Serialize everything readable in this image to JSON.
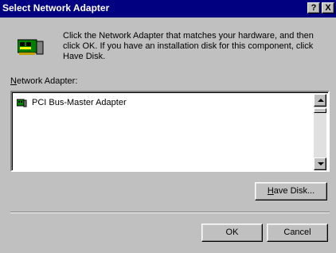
{
  "window": {
    "title": "Select Network Adapter",
    "help_glyph": "?",
    "close_glyph": "X"
  },
  "instructions": "Click the Network Adapter that matches your hardware, and then click OK.  If you have an installation disk for this component, click Have Disk.",
  "list_label": {
    "accel": "N",
    "rest": "etwork Adapter:"
  },
  "adapters": [
    {
      "label": "PCI Bus-Master Adapter",
      "icon": "network-card-icon"
    }
  ],
  "buttons": {
    "have_disk": {
      "accel": "H",
      "rest": "ave Disk..."
    },
    "ok": "OK",
    "cancel": "Cancel"
  },
  "colors": {
    "title_bar": "#000080",
    "face": "#c0c0c0"
  }
}
